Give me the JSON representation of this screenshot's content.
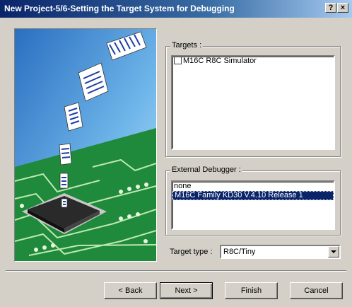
{
  "window": {
    "title": "New Project-5/6-Setting the Target System for Debugging",
    "help_button": "?",
    "close_button": "×"
  },
  "targets": {
    "label": "Targets :",
    "items": [
      {
        "label": "M16C R8C Simulator",
        "checked": false
      }
    ]
  },
  "external_debugger": {
    "label": "External Debugger :",
    "items": [
      {
        "label": "none",
        "selected": false
      },
      {
        "label": "M16C Family KD30 V.4.10 Release 1",
        "selected": true
      }
    ]
  },
  "target_type": {
    "label": "Target type :",
    "value": "R8C/Tiny"
  },
  "buttons": {
    "back": "< Back",
    "next": "Next >",
    "finish": "Finish",
    "cancel": "Cancel"
  },
  "colors": {
    "title_gradient_start": "#0a246a",
    "selection": "#0a246a",
    "dialog_face": "#d4d0c8",
    "pcb_green": "#1f8a3c"
  }
}
